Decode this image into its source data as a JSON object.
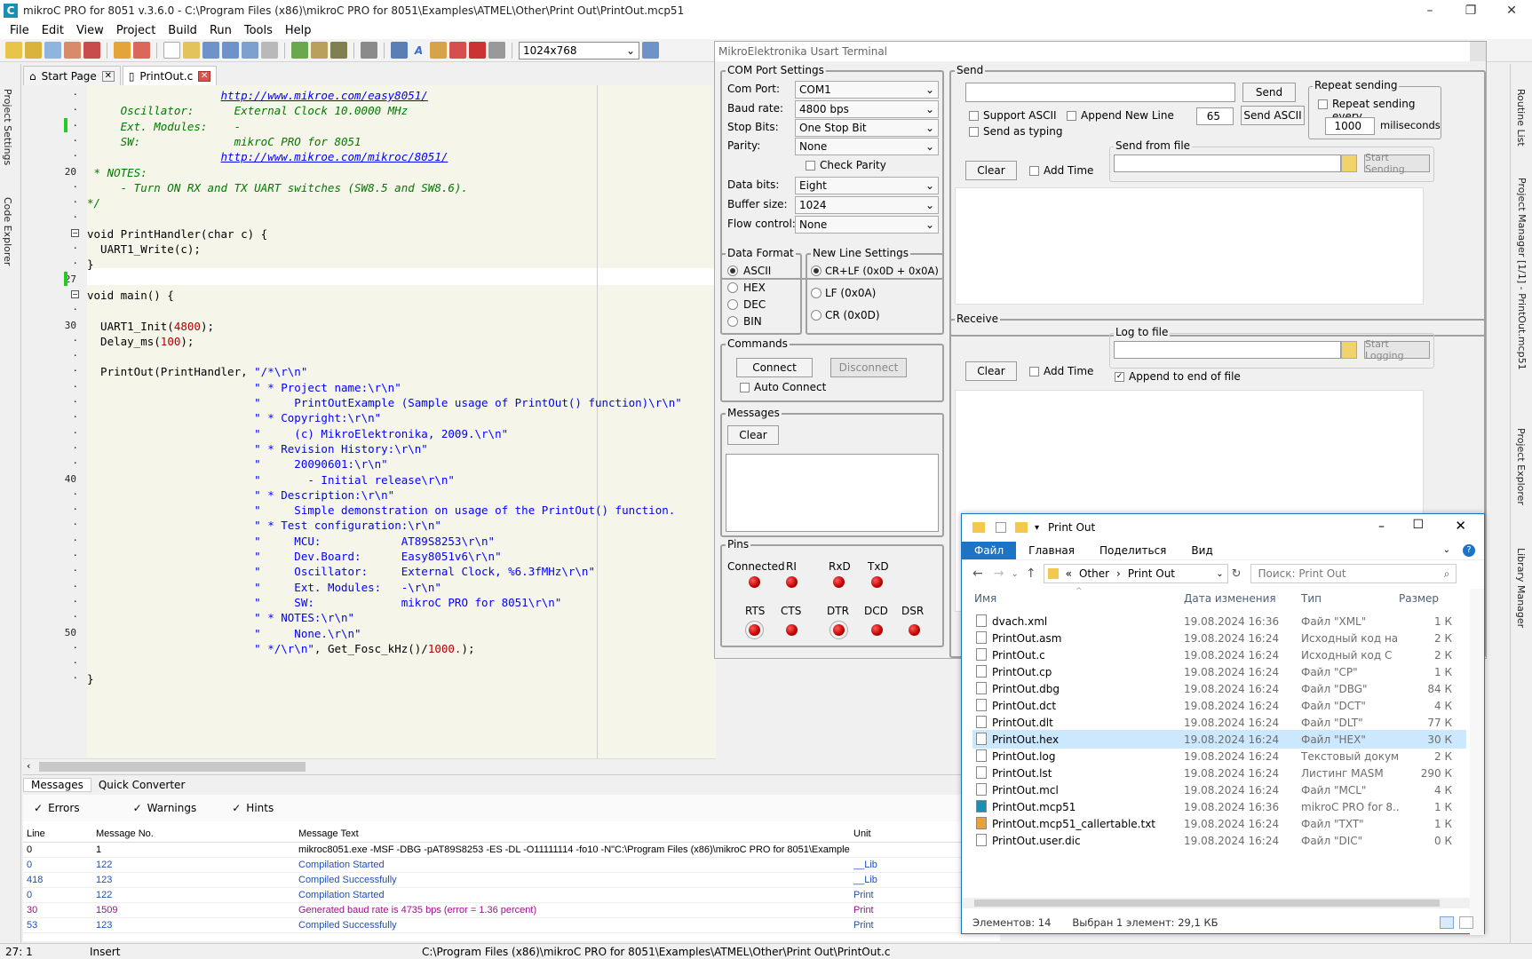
{
  "window": {
    "title": "mikroC PRO for 8051 v.3.6.0 - C:\\Program Files (x86)\\mikroC PRO for 8051\\Examples\\ATMEL\\Other\\Print Out\\PrintOut.mcp51",
    "app_icon_letter": "C",
    "min": "–",
    "max": "❐",
    "close": "✕"
  },
  "menu": [
    "File",
    "Edit",
    "View",
    "Project",
    "Build",
    "Run",
    "Tools",
    "Help"
  ],
  "toolbar": {
    "resolution": "1024x768"
  },
  "left_tabs": [
    "Project Settings",
    "Code Explorer"
  ],
  "right_tabs": [
    "Routine List",
    "Project Manager [1/1] - PrintOut.mcp51",
    "Project Explorer",
    "Library Manager"
  ],
  "doc_tabs": [
    {
      "label": "Start Page"
    },
    {
      "label": "PrintOut.c"
    }
  ],
  "gutter_numbers": [
    {
      "n": "20",
      "line": 5
    },
    {
      "n": "27",
      "line": 12
    },
    {
      "n": "30",
      "line": 15
    },
    {
      "n": "40",
      "line": 25
    },
    {
      "n": "50",
      "line": 35
    }
  ],
  "code_lines": [
    [
      {
        "t": "                    ",
        "c": ""
      },
      {
        "t": "http://www.mikroe.com/easy8051/",
        "c": "url"
      }
    ],
    [
      {
        "t": "     Oscillator:      External Clock 10.0000 MHz",
        "c": "cm"
      }
    ],
    [
      {
        "t": "     Ext. Modules:    -",
        "c": "cm"
      }
    ],
    [
      {
        "t": "     SW:              mikroC PRO for 8051",
        "c": "cm"
      }
    ],
    [
      {
        "t": "                    ",
        "c": ""
      },
      {
        "t": "http://www.mikroe.com/mikroc/8051/",
        "c": "url"
      }
    ],
    [
      {
        "t": " * NOTES:",
        "c": "cm"
      }
    ],
    [
      {
        "t": "     - Turn ON RX and TX UART switches (SW8.5 and SW8.6).",
        "c": "cm"
      }
    ],
    [
      {
        "t": "*/",
        "c": "cm"
      }
    ],
    [
      {
        "t": "",
        "c": ""
      }
    ],
    [
      {
        "t": "void PrintHandler(char c) {",
        "c": ""
      }
    ],
    [
      {
        "t": "  UART1_Write(c);",
        "c": ""
      }
    ],
    [
      {
        "t": "}",
        "c": ""
      }
    ],
    [
      {
        "t": "",
        "c": ""
      }
    ],
    [
      {
        "t": "void main() {",
        "c": ""
      }
    ],
    [
      {
        "t": "",
        "c": ""
      }
    ],
    [
      {
        "t": "  UART1_Init(",
        "c": ""
      },
      {
        "t": "4800",
        "c": "num"
      },
      {
        "t": ");",
        "c": ""
      }
    ],
    [
      {
        "t": "  Delay_ms(",
        "c": ""
      },
      {
        "t": "100",
        "c": "num"
      },
      {
        "t": ");",
        "c": ""
      }
    ],
    [
      {
        "t": "",
        "c": ""
      }
    ],
    [
      {
        "t": "  PrintOut(PrintHandler, ",
        "c": ""
      },
      {
        "t": "\"/*\\r\\n\"",
        "c": "str"
      }
    ],
    [
      {
        "t": "                         ",
        "c": ""
      },
      {
        "t": "\" * Project name:\\r\\n\"",
        "c": "str"
      }
    ],
    [
      {
        "t": "                         ",
        "c": ""
      },
      {
        "t": "\"     PrintOutExample (Sample usage of PrintOut() function)\\r\\n\"",
        "c": "str"
      }
    ],
    [
      {
        "t": "                         ",
        "c": ""
      },
      {
        "t": "\" * Copyright:\\r\\n\"",
        "c": "str"
      }
    ],
    [
      {
        "t": "                         ",
        "c": ""
      },
      {
        "t": "\"     (c) MikroElektronika, 2009.\\r\\n\"",
        "c": "str"
      }
    ],
    [
      {
        "t": "                         ",
        "c": ""
      },
      {
        "t": "\" * Revision History:\\r\\n\"",
        "c": "str"
      }
    ],
    [
      {
        "t": "                         ",
        "c": ""
      },
      {
        "t": "\"     20090601:\\r\\n\"",
        "c": "str"
      }
    ],
    [
      {
        "t": "                         ",
        "c": ""
      },
      {
        "t": "\"       - Initial release\\r\\n\"",
        "c": "str"
      }
    ],
    [
      {
        "t": "                         ",
        "c": ""
      },
      {
        "t": "\" * Description:\\r\\n\"",
        "c": "str"
      }
    ],
    [
      {
        "t": "                         ",
        "c": ""
      },
      {
        "t": "\"     Simple demonstration on usage of the PrintOut() function.",
        "c": "str"
      }
    ],
    [
      {
        "t": "                         ",
        "c": ""
      },
      {
        "t": "\" * Test configuration:\\r\\n\"",
        "c": "str"
      }
    ],
    [
      {
        "t": "                         ",
        "c": ""
      },
      {
        "t": "\"     MCU:            AT89S8253\\r\\n\"",
        "c": "str"
      }
    ],
    [
      {
        "t": "                         ",
        "c": ""
      },
      {
        "t": "\"     Dev.Board:      Easy8051v6\\r\\n\"",
        "c": "str"
      }
    ],
    [
      {
        "t": "                         ",
        "c": ""
      },
      {
        "t": "\"     Oscillator:     External Clock, %6.3fMHz\\r\\n\"",
        "c": "str"
      }
    ],
    [
      {
        "t": "                         ",
        "c": ""
      },
      {
        "t": "\"     Ext. Modules:   -\\r\\n\"",
        "c": "str"
      }
    ],
    [
      {
        "t": "                         ",
        "c": ""
      },
      {
        "t": "\"     SW:             mikroC PRO for 8051\\r\\n\"",
        "c": "str"
      }
    ],
    [
      {
        "t": "                         ",
        "c": ""
      },
      {
        "t": "\" * NOTES:\\r\\n\"",
        "c": "str"
      }
    ],
    [
      {
        "t": "                         ",
        "c": ""
      },
      {
        "t": "\"     None.\\r\\n\"",
        "c": "str"
      }
    ],
    [
      {
        "t": "                         ",
        "c": ""
      },
      {
        "t": "\" */\\r\\n\"",
        "c": "str"
      },
      {
        "t": ", Get_Fosc_kHz()/",
        "c": ""
      },
      {
        "t": "1000.",
        "c": "num"
      },
      {
        "t": ");",
        "c": ""
      }
    ],
    [
      {
        "t": "",
        "c": ""
      }
    ],
    [
      {
        "t": "}",
        "c": ""
      }
    ]
  ],
  "bottom_tabs": [
    "Messages",
    "Quick Converter"
  ],
  "filters": [
    "Errors",
    "Warnings",
    "Hints"
  ],
  "msg_headers": [
    "Line",
    "Message No.",
    "Message Text",
    "Unit"
  ],
  "messages": [
    {
      "line": "0",
      "no": "1",
      "text": "mikroc8051.exe -MSF -DBG -pAT89S8253 -ES -DL -O11111114 -fo10 -N\"C:\\Program Files (x86)\\mikroC PRO for 8051\\Examples\\ATMEL\\Ot...",
      "unit": "",
      "color": "#000000"
    },
    {
      "line": "0",
      "no": "122",
      "text": "Compilation Started",
      "unit": "__Lib",
      "color": "#1f4fb5"
    },
    {
      "line": "418",
      "no": "123",
      "text": "Compiled Successfully",
      "unit": "__Lib",
      "color": "#1f4fb5"
    },
    {
      "line": "0",
      "no": "122",
      "text": "Compilation Started",
      "unit": "Print",
      "color": "#1f4fb5"
    },
    {
      "line": "30",
      "no": "1509",
      "text": "Generated baud rate is 4735 bps (error = 1.36 percent)",
      "unit": "Print",
      "color": "#a0108c"
    },
    {
      "line": "53",
      "no": "123",
      "text": "Compiled Successfully",
      "unit": "Print",
      "color": "#1f4fb5"
    }
  ],
  "status": {
    "pos": "27: 1",
    "mode": "Insert",
    "path": "C:\\Program Files (x86)\\mikroC PRO for 8051\\Examples\\ATMEL\\Other\\Print Out\\PrintOut.c"
  },
  "usart": {
    "title": "MikroElektronika Usart Terminal",
    "com": {
      "group": "COM Port Settings",
      "fields": [
        {
          "label": "Com Port:",
          "value": "COM1"
        },
        {
          "label": "Baud rate:",
          "value": "4800 bps"
        },
        {
          "label": "Stop Bits:",
          "value": "One Stop Bit"
        },
        {
          "label": "Parity:",
          "value": "None"
        }
      ],
      "check_parity": "Check Parity",
      "fields2": [
        {
          "label": "Data bits:",
          "value": "Eight"
        },
        {
          "label": "Buffer size:",
          "value": "1024"
        },
        {
          "label": "Flow control:",
          "value": "None"
        }
      ]
    },
    "data_format": {
      "group": "Data Format",
      "options": [
        "ASCII",
        "HEX",
        "DEC",
        "BIN"
      ],
      "selected": "ASCII"
    },
    "new_line": {
      "group": "New Line Settings",
      "options": [
        "CR+LF (0x0D + 0x0A)",
        "LF (0x0A)",
        "CR (0x0D)"
      ],
      "selected": "CR+LF (0x0D + 0x0A)"
    },
    "commands": {
      "group": "Commands",
      "connect": "Connect",
      "disconnect": "Disconnect",
      "auto_connect": "Auto Connect"
    },
    "messages": {
      "group": "Messages",
      "clear": "Clear"
    },
    "pins": {
      "group": "Pins",
      "top": [
        "Connected",
        "RI",
        "RxD",
        "TxD"
      ],
      "bottom": [
        "RTS",
        "CTS",
        "DTR",
        "DCD",
        "DSR"
      ]
    },
    "send": {
      "group": "Send",
      "send_btn": "Send",
      "support_ascii": "Support ASCII",
      "append_new_line": "Append New Line",
      "ascii_code": "65",
      "send_ascii": "Send ASCII",
      "send_as_typing": "Send as typing",
      "repeat_group": "Repeat sending",
      "repeat_every": "Repeat sending every",
      "repeat_ms": "1000",
      "milliseconds": "miliseconds",
      "from_file": "Send from file",
      "start_sending": "Start Sending",
      "clear": "Clear",
      "add_time": "Add Time"
    },
    "receive": {
      "group": "Receive",
      "log_to_file": "Log to file",
      "start_logging": "Start Logging",
      "clear": "Clear",
      "add_time": "Add Time",
      "append_end": "Append to end of file"
    }
  },
  "explorer": {
    "title": "Print Out",
    "ribbon": [
      "Файл",
      "Главная",
      "Поделиться",
      "Вид"
    ],
    "path": [
      "Other",
      "Print Out"
    ],
    "search_placeholder": "Поиск: Print Out",
    "headers": [
      "Имя",
      "Дата изменения",
      "Тип",
      "Размер"
    ],
    "files": [
      {
        "name": "dvach.xml",
        "date": "19.08.2024 16:36",
        "type": "Файл \"XML\"",
        "size": "1 К",
        "icon": "xml-file-icon"
      },
      {
        "name": "PrintOut.asm",
        "date": "19.08.2024 16:24",
        "type": "Исходный код на...",
        "size": "2 К",
        "icon": "asm-file-icon"
      },
      {
        "name": "PrintOut.c",
        "date": "19.08.2024 16:24",
        "type": "Исходный код C",
        "size": "2 К",
        "icon": "c-file-icon"
      },
      {
        "name": "PrintOut.cp",
        "date": "19.08.2024 16:24",
        "type": "Файл \"CP\"",
        "size": "1 К",
        "icon": "file-icon"
      },
      {
        "name": "PrintOut.dbg",
        "date": "19.08.2024 16:24",
        "type": "Файл \"DBG\"",
        "size": "84 К",
        "icon": "file-icon"
      },
      {
        "name": "PrintOut.dct",
        "date": "19.08.2024 16:24",
        "type": "Файл \"DCT\"",
        "size": "4 К",
        "icon": "file-icon"
      },
      {
        "name": "PrintOut.dlt",
        "date": "19.08.2024 16:24",
        "type": "Файл \"DLT\"",
        "size": "77 К",
        "icon": "file-icon"
      },
      {
        "name": "PrintOut.hex",
        "date": "19.08.2024 16:24",
        "type": "Файл \"HEX\"",
        "size": "30 К",
        "icon": "file-icon"
      },
      {
        "name": "PrintOut.log",
        "date": "19.08.2024 16:24",
        "type": "Текстовый докум...",
        "size": "2 К",
        "icon": "file-icon"
      },
      {
        "name": "PrintOut.lst",
        "date": "19.08.2024 16:24",
        "type": "Листинг MASM",
        "size": "290 К",
        "icon": "file-icon"
      },
      {
        "name": "PrintOut.mcl",
        "date": "19.08.2024 16:24",
        "type": "Файл \"MCL\"",
        "size": "4 К",
        "icon": "file-icon"
      },
      {
        "name": "PrintOut.mcp51",
        "date": "19.08.2024 16:36",
        "type": "mikroC PRO for 8...",
        "size": "1 К",
        "icon": "mikroc-project-icon"
      },
      {
        "name": "PrintOut.mcp51_callertable.txt",
        "date": "19.08.2024 16:24",
        "type": "Файл \"TXT\"",
        "size": "1 К",
        "icon": "txt-file-icon"
      },
      {
        "name": "PrintOut.user.dic",
        "date": "19.08.2024 16:24",
        "type": "Файл \"DIC\"",
        "size": "0 К",
        "icon": "file-icon"
      }
    ],
    "selected": "PrintOut.hex",
    "status_count": "Элементов: 14",
    "status_selected": "Выбран 1 элемент: 29,1 КБ"
  }
}
